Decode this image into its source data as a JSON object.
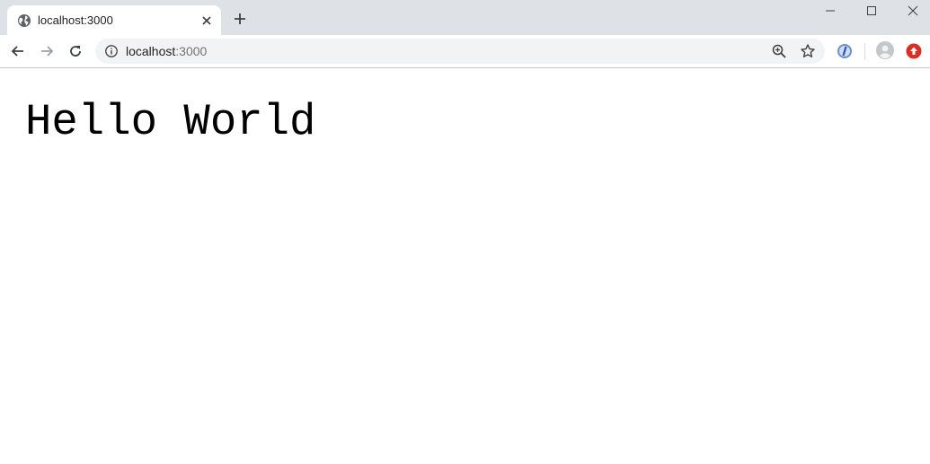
{
  "tab": {
    "title": "localhost:3000",
    "favicon": "globe-icon"
  },
  "window_controls": [
    "minimize-icon",
    "maximize-icon",
    "close-icon"
  ],
  "toolbar": {
    "icons": [
      "back-arrow-icon",
      "forward-arrow-icon",
      "reload-icon"
    ]
  },
  "omnibox": {
    "host": "localhost",
    "port": ":3000",
    "icons": [
      "info-icon",
      "zoom-icon",
      "star-icon"
    ]
  },
  "extensions": [
    "extension-icon",
    "avatar-icon",
    "update-icon"
  ],
  "page": {
    "heading": "Hello World"
  },
  "colors": {
    "tabstrip": "#dee1e6",
    "omnibox_bg": "#f1f3f4",
    "update_red": "#d93025"
  }
}
